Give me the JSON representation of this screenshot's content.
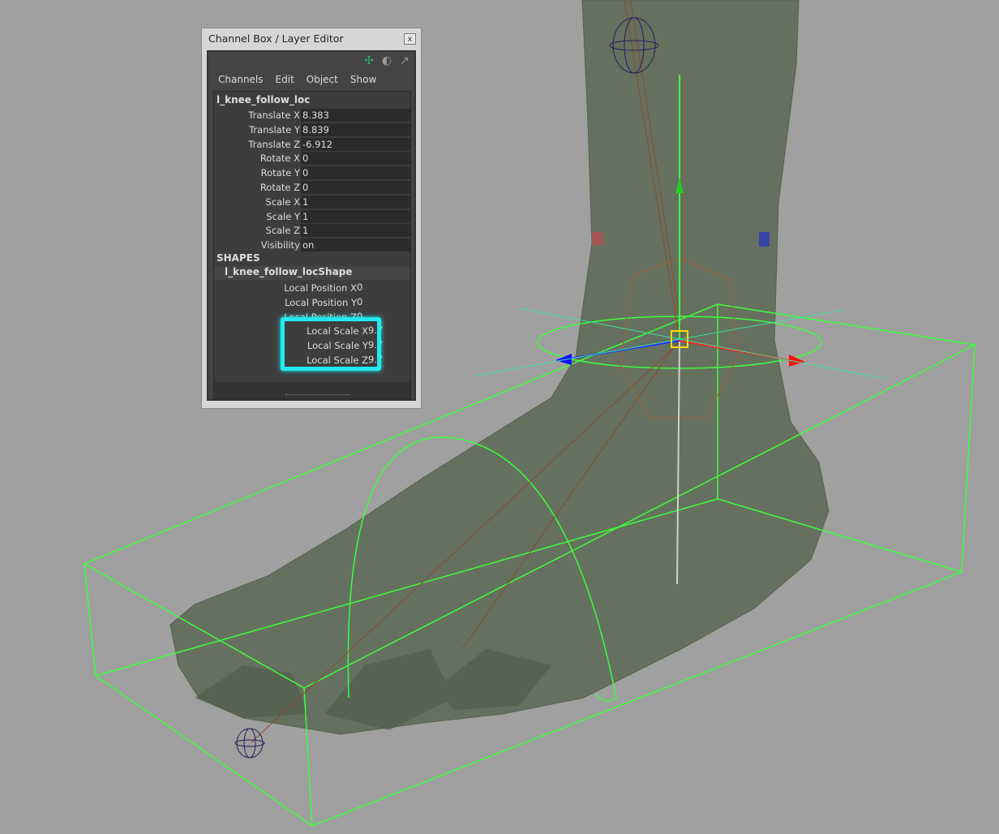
{
  "window": {
    "title": "Channel Box / Layer Editor",
    "close_label": "x"
  },
  "toolbar_icons": [
    "axis-icon",
    "display-toggle-icon",
    "arrow-icon"
  ],
  "menu": [
    "Channels",
    "Edit",
    "Object",
    "Show"
  ],
  "object_name": "l_knee_follow_loc",
  "channels": [
    {
      "label": "Translate X",
      "value": "8.383"
    },
    {
      "label": "Translate Y",
      "value": "8.839"
    },
    {
      "label": "Translate Z",
      "value": "-6.912"
    },
    {
      "label": "Rotate X",
      "value": "0"
    },
    {
      "label": "Rotate Y",
      "value": "0"
    },
    {
      "label": "Rotate Z",
      "value": "0"
    },
    {
      "label": "Scale X",
      "value": "1"
    },
    {
      "label": "Scale Y",
      "value": "1"
    },
    {
      "label": "Scale Z",
      "value": "1"
    },
    {
      "label": "Visibility",
      "value": "on"
    }
  ],
  "shapes_header": "SHAPES",
  "shape_name": "l_knee_follow_locShape",
  "shape_channels": [
    {
      "label": "Local Position X",
      "value": "0"
    },
    {
      "label": "Local Position Y",
      "value": "0"
    },
    {
      "label": "Local Position Z",
      "value": "0"
    },
    {
      "label": "Local Scale X",
      "value": "9.7"
    },
    {
      "label": "Local Scale Y",
      "value": "9.7"
    },
    {
      "label": "Local Scale Z",
      "value": "9.7"
    }
  ],
  "colors": {
    "viewport": "#a0a0a0",
    "highlight": "#22e8f0",
    "wire": "#3cff3c"
  }
}
